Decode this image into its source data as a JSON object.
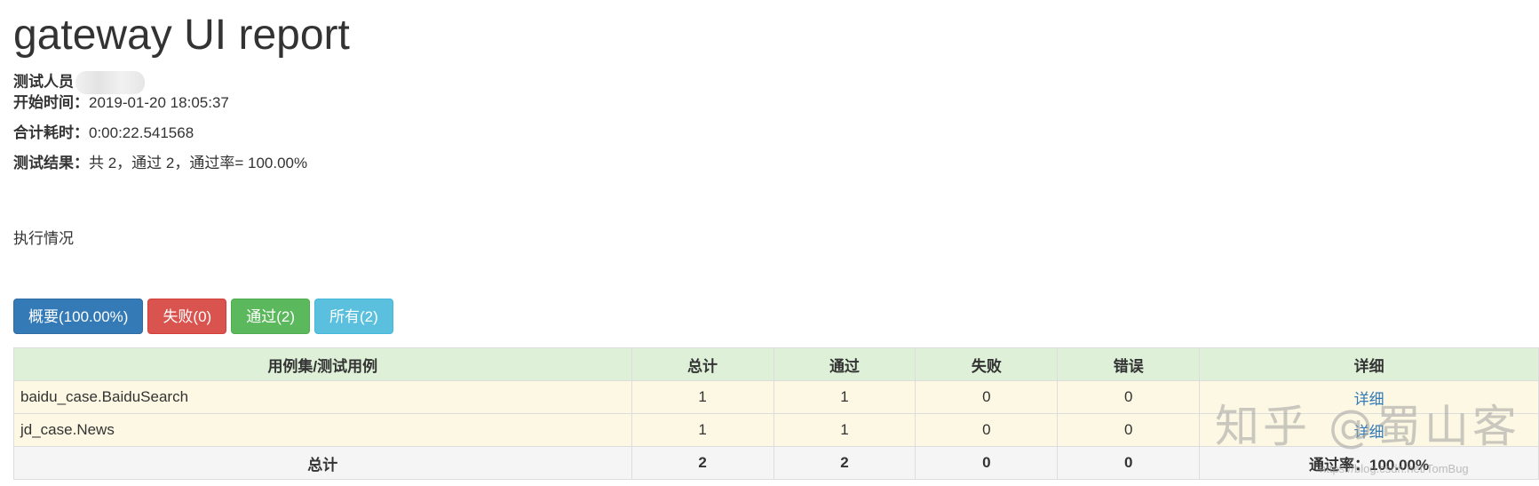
{
  "report": {
    "title": "gateway UI report",
    "tester_label": "测试人员",
    "start_label": "开始时间：",
    "start_value": "2019-01-20 18:05:37",
    "duration_label": "合计耗时：",
    "duration_value": "0:00:22.541568",
    "result_label": "测试结果：",
    "result_value": "共 2，通过 2，通过率= 100.00%",
    "exec_label": "执行情况"
  },
  "filters": {
    "summary": "概要(100.00%)",
    "failed": "失败(0)",
    "passed": "通过(2)",
    "all": "所有(2)"
  },
  "table": {
    "headers": [
      "用例集/测试用例",
      "总计",
      "通过",
      "失败",
      "错误",
      "详细"
    ],
    "rows": [
      {
        "name": "baidu_case.BaiduSearch",
        "total": "1",
        "pass": "1",
        "fail": "0",
        "error": "0",
        "detail": "详细"
      },
      {
        "name": "jd_case.News",
        "total": "1",
        "pass": "1",
        "fail": "0",
        "error": "0",
        "detail": "详细"
      }
    ],
    "total_row": {
      "label": "总计",
      "total": "2",
      "pass": "2",
      "fail": "0",
      "error": "0",
      "rate": "通过率：100.00%"
    }
  },
  "watermark": {
    "main": "知乎 @蜀山客",
    "sub": "https://blog.csdn.net/TomBug"
  },
  "colors": {
    "primary": "#337ab7",
    "danger": "#d9534f",
    "success": "#5cb85c",
    "info": "#5bc0de",
    "header_bg": "#dff0d8",
    "row_bg": "#fcf8e3"
  }
}
